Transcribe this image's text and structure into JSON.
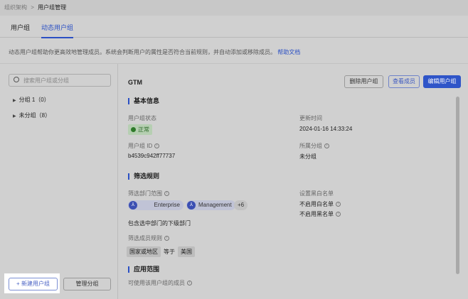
{
  "breadcrumb": {
    "parent": "组织架构",
    "separator": ">",
    "current": "用户组管理"
  },
  "tabs": [
    {
      "label": "用户组"
    },
    {
      "label": "动态用户组"
    }
  ],
  "description": {
    "text": "动态用户组帮助你更高效地管理成员。系统会判断用户的属性是否符合当前规则，并自动添加或移除成员。",
    "link": "帮助文档"
  },
  "sidebar": {
    "search_placeholder": "搜索用户组或分组",
    "groups": [
      {
        "label": "分组 1（0）"
      },
      {
        "label": "未分组（8）"
      }
    ],
    "new_button": "+ 新建用户组",
    "manage_button": "管理分组"
  },
  "detail": {
    "title": "GTM",
    "actions": {
      "delete": "删除用户组",
      "view": "查看成员",
      "edit": "编辑用户组"
    },
    "basic": {
      "heading": "基本信息",
      "status_label": "用户组状态",
      "status": "正常",
      "updated_label": "更新时间",
      "updated": "2024-01-16 14:33:24",
      "id_label": "用户组 ID",
      "id": "b4539c942ff77737",
      "group_label": "所属分组",
      "group": "未分组"
    },
    "rules": {
      "heading": "筛选规则",
      "dept_label": "筛选部门范围",
      "depts": [
        "Enterprise",
        "Management"
      ],
      "more": "+6",
      "include_sub": "包含选中部门的下级部门",
      "member_rule_label": "筛选成员规则",
      "rule": {
        "field": "国家或地区",
        "op": "等于",
        "value": "美国"
      },
      "list_label": "设置黑白名单",
      "whitelist": "不启用白名单",
      "blacklist": "不启用黑名单"
    },
    "scope": {
      "heading": "应用范围",
      "members_label": "可使用该用户组的成员"
    }
  }
}
